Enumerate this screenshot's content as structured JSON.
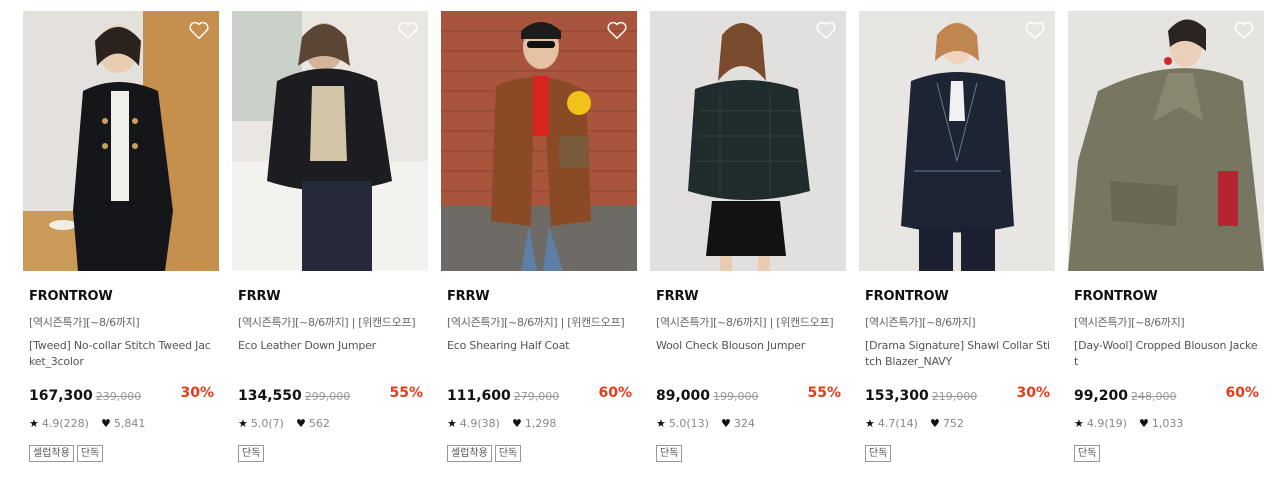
{
  "products": [
    {
      "brand": "FRONTROW",
      "promo": "[역시즌특가][~8/6까지]",
      "name": "[Tweed] No-collar Stitch Tweed Jacket_3color",
      "price": "167,300",
      "original_price": "239,000",
      "discount": "30%",
      "rating": "4.9(228)",
      "likes": "5,841",
      "tags": [
        "셀럽착용",
        "단독"
      ]
    },
    {
      "brand": "FRRW",
      "promo": "[역시즌특가][~8/6까지] | [위캔드오프]",
      "name": "Eco Leather Down Jumper",
      "price": "134,550",
      "original_price": "299,000",
      "discount": "55%",
      "rating": "5.0(7)",
      "likes": "562",
      "tags": [
        "단독"
      ]
    },
    {
      "brand": "FRRW",
      "promo": "[역시즌특가][~8/6까지] | [위캔드오프]",
      "name": "Eco Shearing Half Coat",
      "price": "111,600",
      "original_price": "279,000",
      "discount": "60%",
      "rating": "4.9(38)",
      "likes": "1,298",
      "tags": [
        "셀럽착용",
        "단독"
      ]
    },
    {
      "brand": "FRRW",
      "promo": "[역시즌특가][~8/6까지] | [위캔드오프]",
      "name": "Wool Check Blouson Jumper",
      "price": "89,000",
      "original_price": "199,000",
      "discount": "55%",
      "rating": "5.0(13)",
      "likes": "324",
      "tags": [
        "단독"
      ]
    },
    {
      "brand": "FRONTROW",
      "promo": "[역시즌특가][~8/6까지]",
      "name": "[Drama Signature] Shawl Collar Stitch Blazer_NAVY",
      "price": "153,300",
      "original_price": "219,000",
      "discount": "30%",
      "rating": "4.7(14)",
      "likes": "752",
      "tags": [
        "단독"
      ]
    },
    {
      "brand": "FRONTROW",
      "promo": "[역시즌특가][~8/6까지]",
      "name": "[Day-Wool] Cropped Blouson Jacket",
      "price": "99,200",
      "original_price": "248,000",
      "discount": "60%",
      "rating": "4.9(19)",
      "likes": "1,033",
      "tags": [
        "단독"
      ]
    }
  ],
  "icons": {
    "wishlist": "heart-outline-icon",
    "rating": "star-icon",
    "likes": "heart-icon"
  },
  "colors": {
    "discount": "#ea3a17",
    "text": "#111111",
    "muted": "#888888"
  }
}
